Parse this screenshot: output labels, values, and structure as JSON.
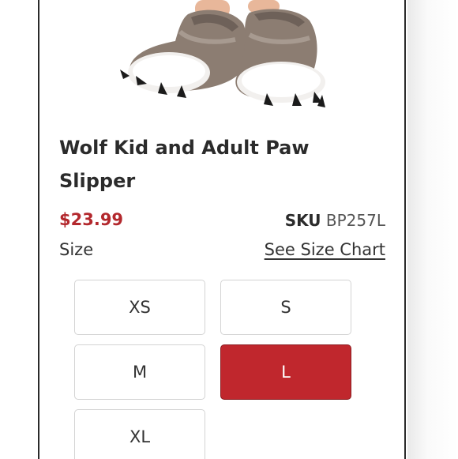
{
  "product": {
    "title": "Wolf Kid and Adult Paw Slipper",
    "price": "$23.99",
    "sku_label": "SKU",
    "sku_value": "BP257L",
    "size_label": "Size",
    "size_chart_link": "See Size Chart"
  },
  "sizes": [
    {
      "label": "XS",
      "selected": false
    },
    {
      "label": "S",
      "selected": false
    },
    {
      "label": "M",
      "selected": false
    },
    {
      "label": "L",
      "selected": true
    },
    {
      "label": "XL",
      "selected": false
    }
  ],
  "colors": {
    "price": "#b3282d",
    "selected_size_bg": "#c0272d",
    "text": "#333333"
  }
}
